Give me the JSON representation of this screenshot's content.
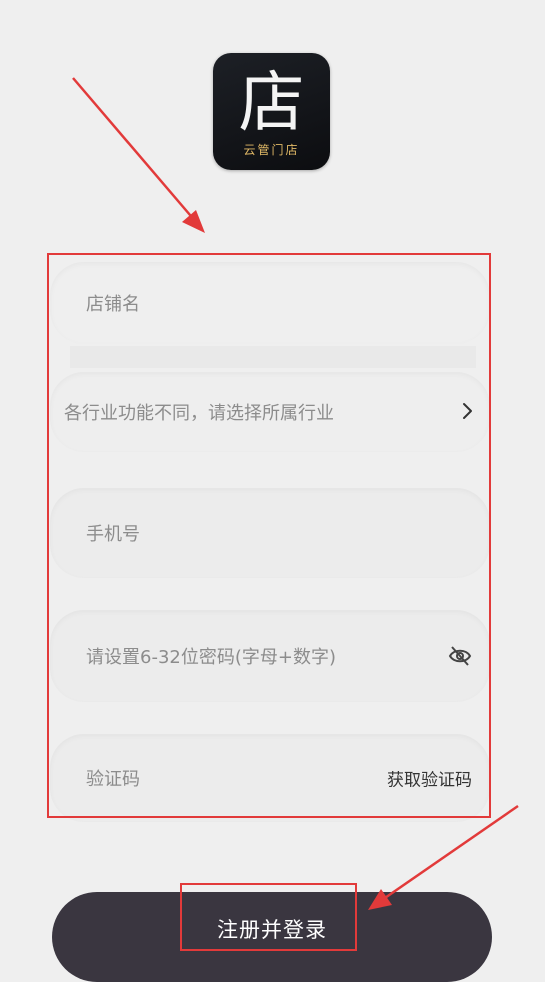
{
  "logo": {
    "char": "店",
    "subtitle": "云管门店",
    "text_color": "#e0b866"
  },
  "form": {
    "shop_name": {
      "placeholder": "店铺名"
    },
    "industry": {
      "placeholder": "各行业功能不同，请选择所属行业",
      "icon": "chevron-right-icon"
    },
    "phone": {
      "placeholder": "手机号"
    },
    "password": {
      "placeholder": "请设置6-32位密码(字母+数字)",
      "icon": "eye-off-icon"
    },
    "code": {
      "placeholder": "验证码",
      "action": "获取验证码"
    }
  },
  "submit": {
    "label": "注册并登录"
  },
  "annotations": {
    "color": "#e23a3a"
  }
}
